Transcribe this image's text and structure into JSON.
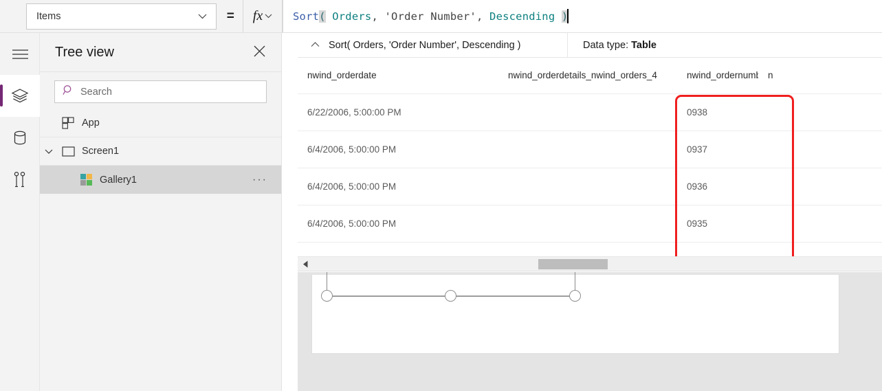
{
  "topbar": {
    "property_dropdown": {
      "value": "Items",
      "icon": "chevron-down-icon"
    },
    "equals_sign": "=",
    "fx_label": "fx",
    "formula": {
      "full_text": "Sort( Orders, 'Order Number', Descending )",
      "tokens": [
        {
          "text": "Sort",
          "kind": "function"
        },
        {
          "text": "(",
          "kind": "paren-highlight"
        },
        {
          "text": " ",
          "kind": "plain"
        },
        {
          "text": "Orders",
          "kind": "identifier"
        },
        {
          "text": ", ",
          "kind": "punct"
        },
        {
          "text": "'Order Number'",
          "kind": "string"
        },
        {
          "text": ", ",
          "kind": "punct"
        },
        {
          "text": "Descending",
          "kind": "identifier"
        },
        {
          "text": " ",
          "kind": "plain"
        },
        {
          "text": ")",
          "kind": "paren-highlight"
        }
      ]
    }
  },
  "rail": {
    "items": [
      {
        "name": "hamburger-menu-icon",
        "label": "Menu",
        "active": false
      },
      {
        "name": "layers-icon",
        "label": "Tree view",
        "active": true
      },
      {
        "name": "database-icon",
        "label": "Data",
        "active": false
      },
      {
        "name": "tools-icon",
        "label": "Media",
        "active": false
      }
    ],
    "accent_color": "#742774"
  },
  "tree": {
    "title": "Tree view",
    "close_label": "✕",
    "search": {
      "placeholder": "Search",
      "value": "",
      "icon_color": "#9b4f96"
    },
    "items": [
      {
        "label": "App",
        "icon": "app-grid-icon",
        "indent": 0,
        "selected": false,
        "expander": "",
        "menu": false
      },
      {
        "label": "Screen1",
        "icon": "screen-rect-icon",
        "indent": 0,
        "selected": false,
        "expander": "chevron-down-icon",
        "menu": false
      },
      {
        "label": "Gallery1",
        "icon": "gallery-icon",
        "indent": 1,
        "selected": true,
        "expander": "",
        "menu": true
      }
    ],
    "gallery_icon_colors": [
      "#37a3a3",
      "#f2b749",
      "#9a9a9a",
      "#57b857"
    ],
    "overflow_menu_label": "···"
  },
  "result": {
    "expression": "Sort( Orders, 'Order Number', Descending )",
    "collapse_icon": "chevron-up-icon",
    "data_type_label": "Data type:",
    "data_type_value": "Table"
  },
  "grid": {
    "columns": [
      {
        "key": "nwind_orderdate",
        "header": "nwind_orderdate"
      },
      {
        "key": "nwind_orderdetails_nwind_orders_4",
        "header": "nwind_orderdetails_nwind_orders_4"
      },
      {
        "key": "nwind_ordernumber",
        "header": "nwind_ordernumber"
      },
      {
        "key": "cut_off",
        "header": "n"
      }
    ],
    "rows": [
      {
        "nwind_orderdate": "6/22/2006, 5:00:00 PM",
        "nwind_orderdetails_nwind_orders_4": "",
        "nwind_ordernumber": "0938",
        "cut_off": ""
      },
      {
        "nwind_orderdate": "6/4/2006, 5:00:00 PM",
        "nwind_orderdetails_nwind_orders_4": "",
        "nwind_ordernumber": "0937",
        "cut_off": ""
      },
      {
        "nwind_orderdate": "6/4/2006, 5:00:00 PM",
        "nwind_orderdetails_nwind_orders_4": "",
        "nwind_ordernumber": "0936",
        "cut_off": ""
      },
      {
        "nwind_orderdate": "6/4/2006, 5:00:00 PM",
        "nwind_orderdetails_nwind_orders_4": "",
        "nwind_ordernumber": "0935",
        "cut_off": ""
      }
    ],
    "annotation": {
      "shape": "rounded-rectangle",
      "color": "#f01f1f",
      "target_column": "nwind_ordernumber"
    },
    "scrollbar": {
      "left_arrow": "◀",
      "orientation": "horizontal"
    }
  },
  "canvas": {
    "selected_control": "Gallery1",
    "handles": 3
  }
}
